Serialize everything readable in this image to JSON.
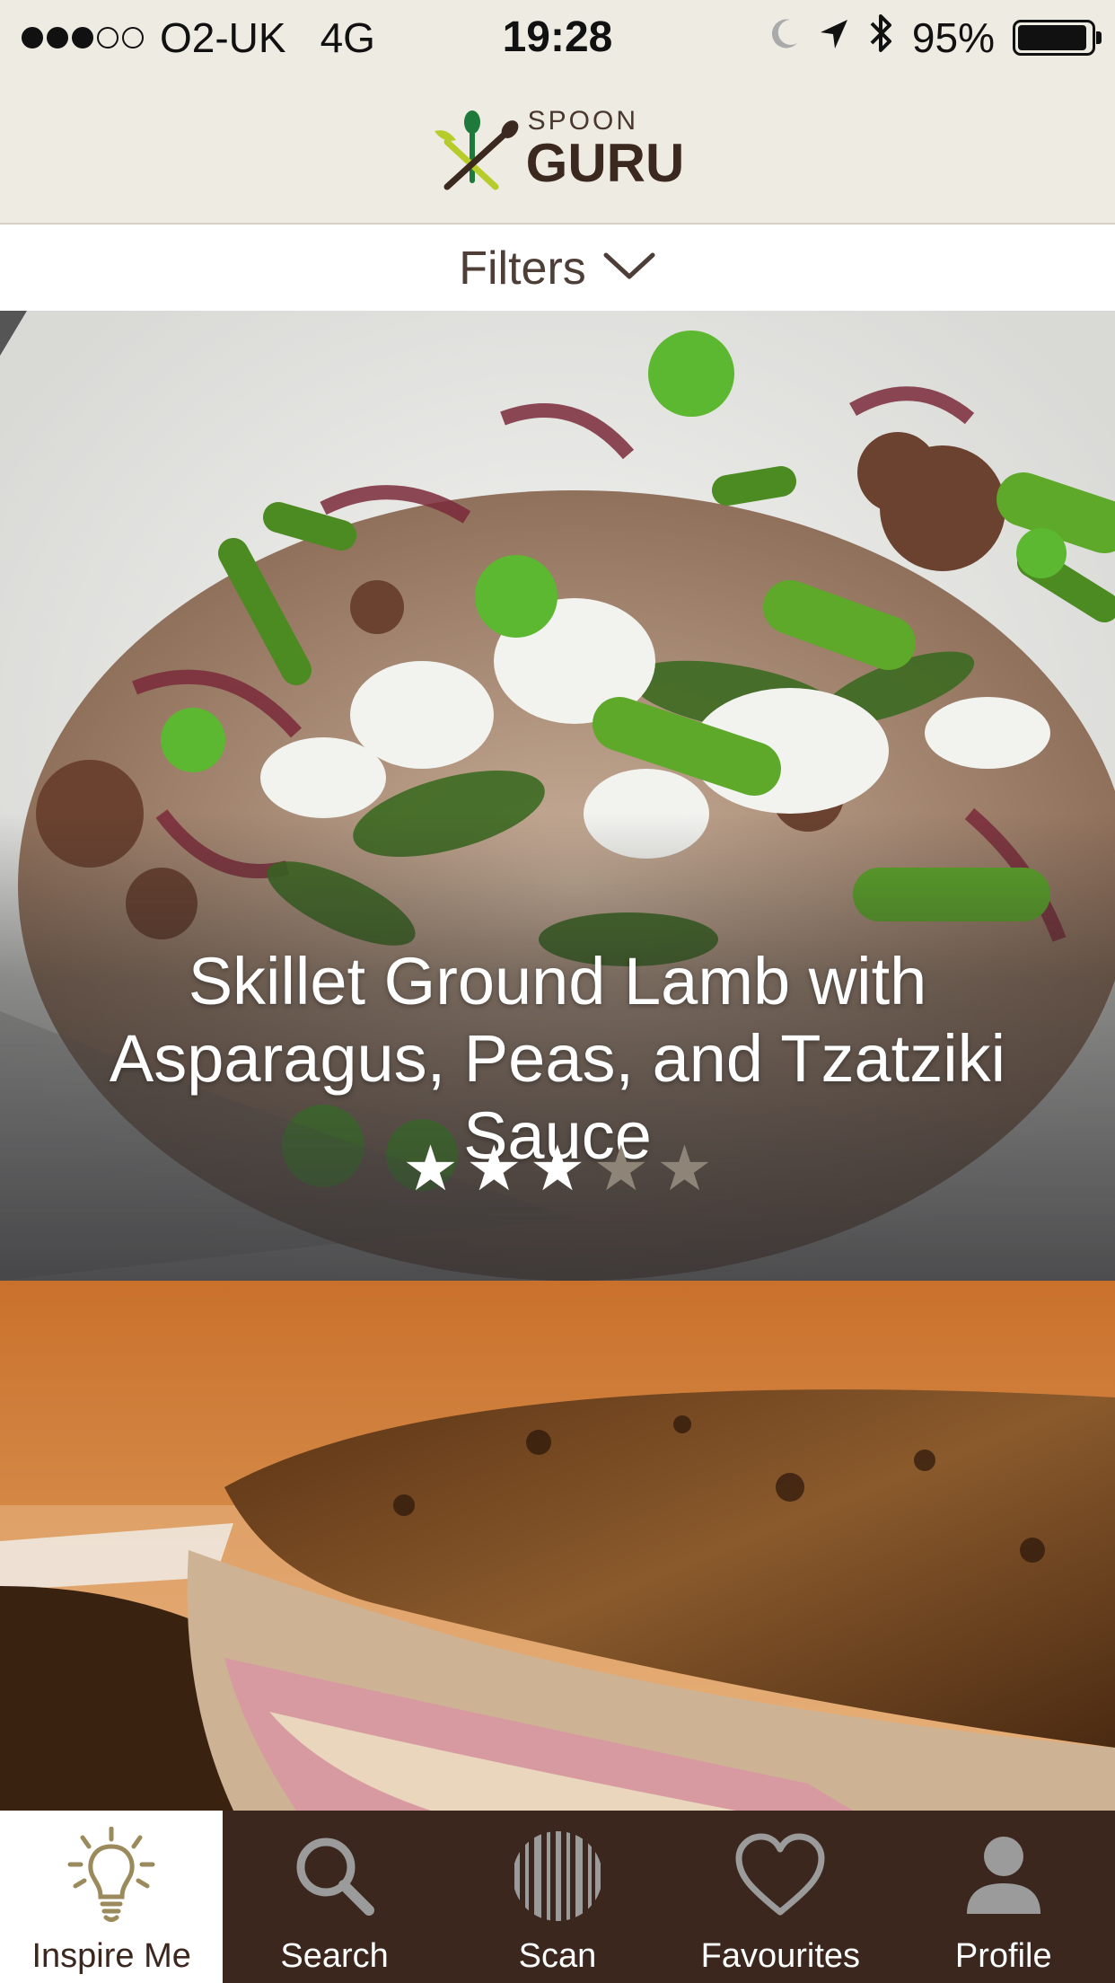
{
  "status_bar": {
    "carrier": "O2-UK",
    "network": "4G",
    "time": "19:28",
    "battery": "95%",
    "battery_level": 0.95,
    "signal_bars": 3,
    "signal_total": 5
  },
  "header": {
    "logo_top": "SPOON",
    "logo_bottom": "GURU"
  },
  "filters": {
    "label": "Filters"
  },
  "recipes": [
    {
      "title": "Skillet Ground Lamb with Asparagus, Peas, and Tzatziki Sauce",
      "rating": 3,
      "rating_max": 5
    },
    {
      "title": ""
    }
  ],
  "tabs": [
    {
      "label": "Inspire Me",
      "icon": "lightbulb-icon",
      "active": true
    },
    {
      "label": "Search",
      "icon": "search-icon",
      "active": false
    },
    {
      "label": "Scan",
      "icon": "barcode-icon",
      "active": false
    },
    {
      "label": "Favourites",
      "icon": "heart-icon",
      "active": false
    },
    {
      "label": "Profile",
      "icon": "person-icon",
      "active": false
    }
  ],
  "colors": {
    "header_bg": "#eeebe3",
    "tab_bar_bg": "#3b271e",
    "tab_active_bg": "#ffffff",
    "brand_green": "#b7cc2a",
    "brand_dark_green": "#1e7a3a",
    "brand_brown": "#3b281f",
    "inspire_icon": "#9a8a5c"
  }
}
